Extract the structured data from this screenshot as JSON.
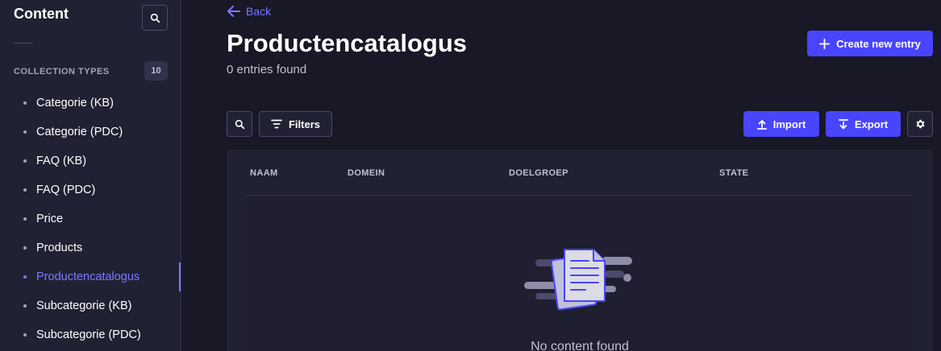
{
  "sidebar": {
    "title": "Content",
    "section_label": "COLLECTION TYPES",
    "count": "10",
    "items": [
      {
        "label": "Categorie (KB)",
        "active": false
      },
      {
        "label": "Categorie (PDC)",
        "active": false
      },
      {
        "label": "FAQ (KB)",
        "active": false
      },
      {
        "label": "FAQ (PDC)",
        "active": false
      },
      {
        "label": "Price",
        "active": false
      },
      {
        "label": "Products",
        "active": false
      },
      {
        "label": "Productencatalogus",
        "active": true
      },
      {
        "label": "Subcategorie (KB)",
        "active": false
      },
      {
        "label": "Subcategorie (PDC)",
        "active": false
      }
    ]
  },
  "header": {
    "back_label": "Back",
    "title": "Productencatalogus",
    "subtitle": "0 entries found",
    "create_label": "Create new entry"
  },
  "toolbar": {
    "filters_label": "Filters",
    "import_label": "Import",
    "export_label": "Export"
  },
  "table": {
    "columns": [
      "NAAM",
      "DOMEIN",
      "DOELGROEP",
      "STATE"
    ],
    "empty_text": "No content found"
  },
  "colors": {
    "accent": "#4945ff",
    "accent_text": "#7b79ff",
    "background": "#181826",
    "panel": "#212134"
  },
  "icons": {
    "back": "arrow-left-icon",
    "search": "search-icon",
    "filter": "filter-icon",
    "plus": "plus-icon",
    "import": "upload-icon",
    "export": "download-icon",
    "settings": "gear-icon",
    "empty": "documents-illustration"
  }
}
